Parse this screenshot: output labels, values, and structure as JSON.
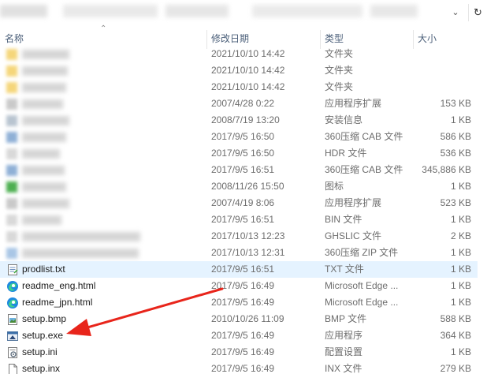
{
  "header": {
    "name": "名称",
    "date": "修改日期",
    "type": "类型",
    "size": "大小"
  },
  "rows": [
    {
      "name": "",
      "date": "2021/10/10 14:42",
      "type": "文件夹",
      "size": "",
      "icon": "folder-icon",
      "blurred": true
    },
    {
      "name": "",
      "date": "2021/10/10 14:42",
      "type": "文件夹",
      "size": "",
      "icon": "folder-icon",
      "blurred": true
    },
    {
      "name": "",
      "date": "2021/10/10 14:42",
      "type": "文件夹",
      "size": "",
      "icon": "folder-icon",
      "blurred": true
    },
    {
      "name": "",
      "date": "2007/4/28 0:22",
      "type": "应用程序扩展",
      "size": "153 KB",
      "icon": "dll-icon",
      "blurred": true
    },
    {
      "name": "",
      "date": "2008/7/19 13:20",
      "type": "安装信息",
      "size": "1 KB",
      "icon": "inf-icon",
      "blurred": true
    },
    {
      "name": "",
      "date": "2017/9/5 16:50",
      "type": "360压缩 CAB 文件",
      "size": "586 KB",
      "icon": "cab-icon",
      "blurred": true
    },
    {
      "name": "",
      "date": "2017/9/5 16:50",
      "type": "HDR 文件",
      "size": "536 KB",
      "icon": "file-icon",
      "blurred": true
    },
    {
      "name": "",
      "date": "2017/9/5 16:51",
      "type": "360压缩 CAB 文件",
      "size": "345,886 KB",
      "icon": "cab-icon",
      "blurred": true
    },
    {
      "name": "",
      "date": "2008/11/26 15:50",
      "type": "图标",
      "size": "1 KB",
      "icon": "ico-icon",
      "blurred": true
    },
    {
      "name": "",
      "date": "2007/4/19 8:06",
      "type": "应用程序扩展",
      "size": "523 KB",
      "icon": "dll-icon",
      "blurred": true
    },
    {
      "name": "",
      "date": "2017/9/5 16:51",
      "type": "BIN 文件",
      "size": "1 KB",
      "icon": "file-icon",
      "blurred": true
    },
    {
      "name": "",
      "date": "2017/10/13 12:23",
      "type": "GHSLIC 文件",
      "size": "2 KB",
      "icon": "file-icon",
      "blurred": true
    },
    {
      "name": "",
      "date": "2017/10/13 12:31",
      "type": "360压缩 ZIP 文件",
      "size": "1 KB",
      "icon": "zip-icon",
      "blurred": true
    },
    {
      "name": "prodlist.txt",
      "date": "2017/9/5 16:51",
      "type": "TXT 文件",
      "size": "1 KB",
      "icon": "txt-icon",
      "blurred": false,
      "hover": true
    },
    {
      "name": "readme_eng.html",
      "date": "2017/9/5 16:49",
      "type": "Microsoft Edge ...",
      "size": "1 KB",
      "icon": "edge-icon",
      "blurred": false
    },
    {
      "name": "readme_jpn.html",
      "date": "2017/9/5 16:49",
      "type": "Microsoft Edge ...",
      "size": "1 KB",
      "icon": "edge-icon",
      "blurred": false
    },
    {
      "name": "setup.bmp",
      "date": "2010/10/26 11:09",
      "type": "BMP 文件",
      "size": "588 KB",
      "icon": "bmp-icon",
      "blurred": false
    },
    {
      "name": "setup.exe",
      "date": "2017/9/5 16:49",
      "type": "应用程序",
      "size": "364 KB",
      "icon": "exe-icon",
      "blurred": false
    },
    {
      "name": "setup.ini",
      "date": "2017/9/5 16:49",
      "type": "配置设置",
      "size": "1 KB",
      "icon": "ini-icon",
      "blurred": false
    },
    {
      "name": "setup.inx",
      "date": "2017/9/5 16:49",
      "type": "INX 文件",
      "size": "279 KB",
      "icon": "file-icon",
      "blurred": false
    }
  ],
  "colors": {
    "hover_row": "#e5f3ff",
    "header_text": "#4c607a",
    "annotation_arrow": "#e8251b"
  }
}
